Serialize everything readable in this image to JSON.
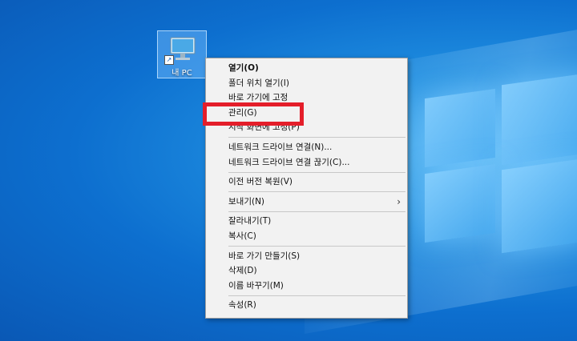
{
  "desktop": {
    "icon_label": "내 PC"
  },
  "context_menu": {
    "items": [
      {
        "label": "열기(O)",
        "bold": true
      },
      {
        "label": "폴더 위치 열기(I)"
      },
      {
        "label": "바로 가기에 고정"
      },
      {
        "label": "관리(G)"
      },
      {
        "label": "시작 화면에 고정(P)"
      },
      {
        "separator": true
      },
      {
        "label": "네트워크 드라이브 연결(N)..."
      },
      {
        "label": "네트워크 드라이브 연결 끊기(C)..."
      },
      {
        "separator": true
      },
      {
        "label": "이전 버전 복원(V)"
      },
      {
        "separator": true
      },
      {
        "label": "보내기(N)",
        "submenu": true
      },
      {
        "separator": true
      },
      {
        "label": "잘라내기(T)"
      },
      {
        "label": "복사(C)"
      },
      {
        "separator": true
      },
      {
        "label": "바로 가기 만들기(S)"
      },
      {
        "label": "삭제(D)"
      },
      {
        "label": "이름 바꾸기(M)"
      },
      {
        "separator": true
      },
      {
        "label": "속성(R)"
      }
    ]
  },
  "highlight": {
    "target": "관리(G)",
    "color": "#e41e2a"
  }
}
